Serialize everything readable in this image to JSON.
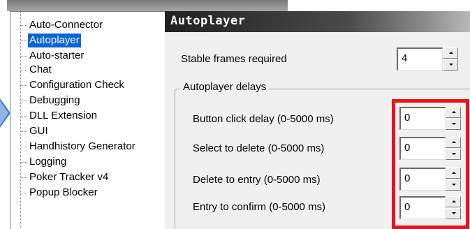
{
  "tree": {
    "items": [
      {
        "label": "Auto-Connector",
        "selected": false
      },
      {
        "label": "Autoplayer",
        "selected": true
      },
      {
        "label": "Auto-starter",
        "selected": false
      },
      {
        "label": "Chat",
        "selected": false
      },
      {
        "label": "Configuration Check",
        "selected": false
      },
      {
        "label": "Debugging",
        "selected": false
      },
      {
        "label": "DLL Extension",
        "selected": false
      },
      {
        "label": "GUI",
        "selected": false
      },
      {
        "label": "Handhistory Generator",
        "selected": false
      },
      {
        "label": "Logging",
        "selected": false
      },
      {
        "label": "Poker Tracker v4",
        "selected": false
      },
      {
        "label": "Popup Blocker",
        "selected": false
      }
    ]
  },
  "panel": {
    "title": "Autoplayer",
    "stable_frames": {
      "label": "Stable frames required",
      "value": "4"
    },
    "group": {
      "title": "Autoplayer delays",
      "rows": [
        {
          "label": "Button click delay (0-5000 ms)",
          "value": "0"
        },
        {
          "label": "Select to delete (0-5000 ms)",
          "value": "0"
        },
        {
          "label": "Delete to entry (0-5000 ms)",
          "value": "0"
        },
        {
          "label": "Entry to confirm (0-5000 ms)",
          "value": "0"
        }
      ]
    }
  },
  "colors": {
    "highlight": "#e8131b",
    "selection": "#0a64d8",
    "arrow": "#3f7ec8"
  },
  "icons": {
    "spin_up": "spin-up-arrow-icon",
    "spin_down": "spin-down-arrow-icon",
    "pointer": "pointer-arrow-icon"
  }
}
